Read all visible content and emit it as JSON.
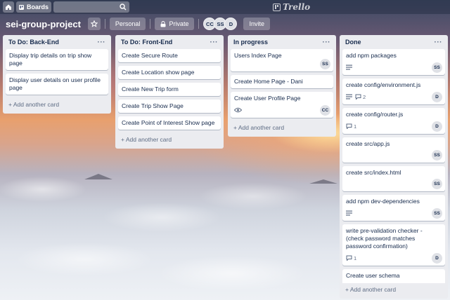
{
  "topbar": {
    "boards_label": "Boards",
    "logo_text": "Trello"
  },
  "board": {
    "title": "sei-group-project",
    "team_label": "Personal",
    "visibility_label": "Private",
    "members": [
      "CC",
      "SS",
      "D"
    ],
    "invite_label": "Invite"
  },
  "lists": [
    {
      "title": "To Do: Back-End",
      "add_label": "+ Add another card",
      "cards": [
        {
          "text": "Display trip details on trip show page"
        },
        {
          "text": "Display user details on user profile page"
        }
      ]
    },
    {
      "title": "To Do: Front-End",
      "add_label": "+ Add another card",
      "cards": [
        {
          "text": "Create Secure Route"
        },
        {
          "text": "Create Location show page"
        },
        {
          "text": "Create New Trip form"
        },
        {
          "text": "Create Trip Show Page"
        },
        {
          "text": "Create Point of Interest Show page"
        }
      ]
    },
    {
      "title": "In progress",
      "add_label": "+ Add another card",
      "cards": [
        {
          "text": "Users Index Page",
          "member": "SS"
        },
        {
          "text": "Create Home Page - Dani"
        },
        {
          "text": "Create User Profile Page",
          "member": "CC",
          "watch": true
        }
      ]
    },
    {
      "title": "Done",
      "add_label": "+ Add another card",
      "cards": [
        {
          "text": "add npm packages",
          "member": "SS",
          "description": true
        },
        {
          "text": "create config/environment.js",
          "member": "D",
          "description": true,
          "comments": "2"
        },
        {
          "text": "create config/router.js",
          "member": "D",
          "comments": "1"
        },
        {
          "text": "create src/app.js",
          "member": "SS"
        },
        {
          "text": "create src/index.html",
          "member": "SS"
        },
        {
          "text": "add npm dev-dependencies",
          "member": "SS",
          "description": true
        },
        {
          "text": "write pre-validation checker - (check password matches password confirmation)",
          "member": "D",
          "comments": "1"
        },
        {
          "text": "Create user schema",
          "comments": "1"
        }
      ]
    }
  ],
  "icons": {
    "home": "home-icon",
    "boards": "boards-icon",
    "search": "search-icon",
    "star": "star-icon",
    "lock": "lock-icon",
    "menu": "list-menu-icon",
    "description": "description-icon",
    "comment": "comment-icon",
    "watch": "eye-icon"
  }
}
